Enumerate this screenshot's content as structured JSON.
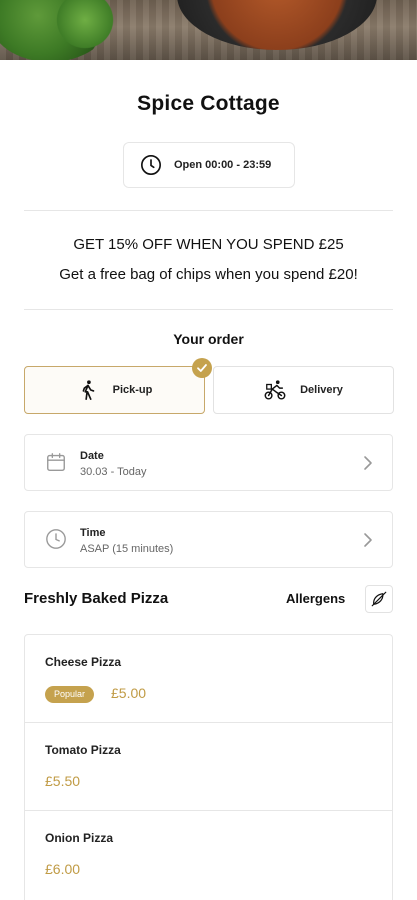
{
  "restaurant": {
    "name": "Spice Cottage",
    "hours": "Open 00:00 - 23:59"
  },
  "promotions": [
    "GET 15% OFF WHEN YOU SPEND £25",
    "Get a free bag of chips when you spend £20!"
  ],
  "order": {
    "heading": "Your order",
    "modes": [
      {
        "label": "Pick-up",
        "selected": true,
        "icon": "walking-person-icon"
      },
      {
        "label": "Delivery",
        "selected": false,
        "icon": "cyclist-icon"
      }
    ],
    "date": {
      "label": "Date",
      "value": "30.03 - Today",
      "icon": "calendar-icon"
    },
    "time": {
      "label": "Time",
      "value": "ASAP (15 minutes)",
      "icon": "clock-icon"
    }
  },
  "menu": {
    "section_title": "Freshly Baked Pizza",
    "allergens_label": "Allergens",
    "items": [
      {
        "name": "Cheese Pizza",
        "badge": "Popular",
        "price": "£5.00"
      },
      {
        "name": "Tomato Pizza",
        "badge": "",
        "price": "£5.50"
      },
      {
        "name": "Onion Pizza",
        "badge": "",
        "price": "£6.00"
      }
    ]
  },
  "colors": {
    "accent": "#c5a24e",
    "price": "#c09b45",
    "border": "#e6e6e6"
  }
}
